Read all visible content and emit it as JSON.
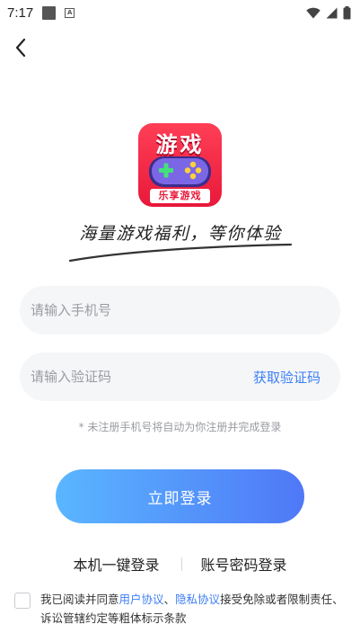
{
  "status_bar": {
    "time": "7:17",
    "icons": [
      "notification-square-icon",
      "a-badge-icon",
      "wifi-icon",
      "signal-icon",
      "battery-icon"
    ]
  },
  "nav": {
    "back_icon": "chevron-left-icon"
  },
  "logo": {
    "title": "游戏",
    "subtitle": "乐享游戏",
    "icon": "gamepad-icon",
    "color": "#e8183a"
  },
  "slogan": "海量游戏福利，等你体验",
  "form": {
    "phone_placeholder": "请输入手机号",
    "phone_value": "",
    "code_placeholder": "请输入验证码",
    "code_value": "",
    "get_code_label": "获取验证码",
    "hint": "* 未注册手机号将自动为你注册并完成登录"
  },
  "login_button": "立即登录",
  "alt_login": {
    "one_click": "本机一键登录",
    "password": "账号密码登录"
  },
  "agreement": {
    "prefix": "我已阅读并同意",
    "user_agreement": "用户协议",
    "sep": "、",
    "privacy": "隐私协议",
    "suffix": "接受免除或者限制责任、诉讼管辖约定等粗体标示条款"
  },
  "colors": {
    "accent": "#3d7ef5",
    "button_start": "#5ab6ff",
    "button_end": "#4f78f7"
  }
}
